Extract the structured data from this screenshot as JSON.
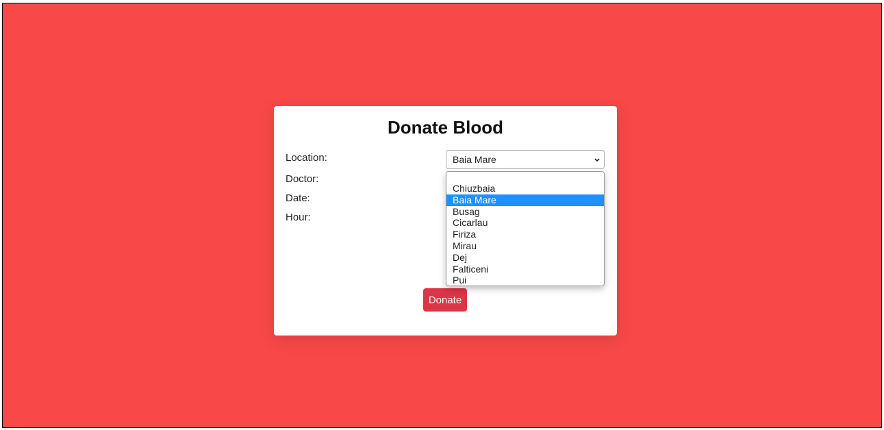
{
  "form": {
    "title": "Donate Blood",
    "labels": {
      "location": "Location:",
      "doctor": "Doctor:",
      "date": "Date:",
      "hour": "Hour:"
    },
    "location_selected": "Baia Mare",
    "location_options": [
      "Chiuzbaia",
      "Baia Mare",
      "Busag",
      "Cicarlau",
      "Firiza",
      "Mirau",
      "Dej",
      "Falticeni",
      "Pui"
    ],
    "submit_label": "Donate"
  },
  "colors": {
    "background": "#f84848",
    "card": "#ffffff",
    "button": "#dc3545",
    "option_highlight": "#1e90ff"
  },
  "icons": {
    "select_arrow": "chevron-down-icon"
  }
}
